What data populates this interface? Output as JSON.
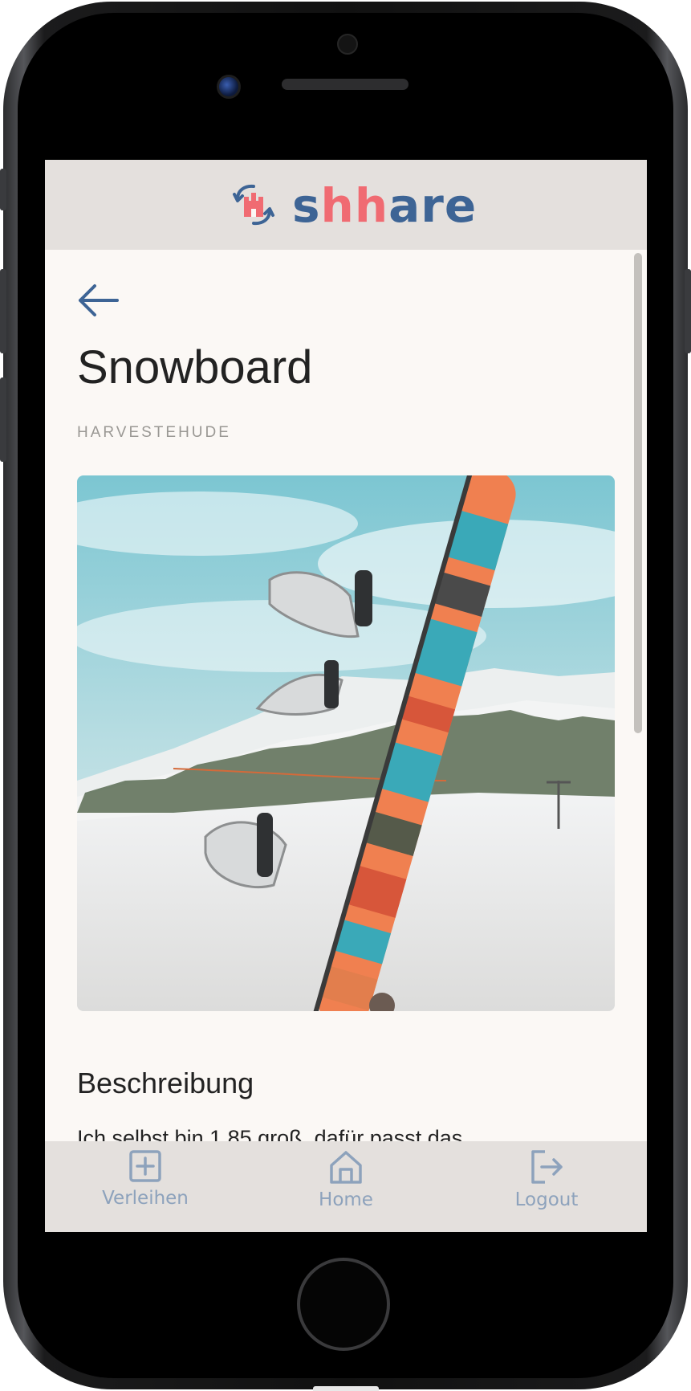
{
  "header": {
    "logo_text_1": "s",
    "logo_text_2": "hh",
    "logo_text_3": "are"
  },
  "product": {
    "title": "Snowboard",
    "location": "HARVESTEHUDE",
    "description_heading": "Beschreibung",
    "description_text": "Ich selbst bin 1,85 groß, dafür passt das"
  },
  "tabs": [
    {
      "label": "Verleihen",
      "icon": "plus-square-icon"
    },
    {
      "label": "Home",
      "icon": "home-icon"
    },
    {
      "label": "Logout",
      "icon": "logout-icon"
    }
  ],
  "colors": {
    "brand_blue": "#3d6495",
    "brand_pink": "#f06b72",
    "bar_bg": "#e4e0dd",
    "page_bg": "#fbf8f5",
    "tab_icon": "#8da2bc"
  }
}
